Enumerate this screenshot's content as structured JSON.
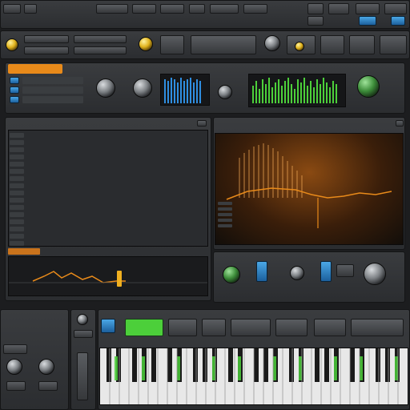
{
  "app": {
    "title": ""
  },
  "top_bar": {
    "items": [
      "",
      "",
      "",
      "",
      ""
    ],
    "status_text": ""
  },
  "instrument_panel": {
    "preset_name": "",
    "track_labels": [
      "",
      "",
      "",
      "",
      ""
    ]
  },
  "editor": {
    "title": "",
    "rows": [
      "",
      "",
      "",
      "",
      "",
      "",
      "",
      "",
      "",
      "",
      "",
      "",
      "",
      "",
      "",
      ""
    ]
  },
  "analyzer": {
    "title": "",
    "header_label": ""
  },
  "effects_panel": {
    "label": ""
  },
  "bottom_left": {
    "label": ""
  },
  "colors": {
    "accent_orange": "#e88a1a",
    "accent_green": "#4ccf3a",
    "accent_blue": "#2f8ee0",
    "panel_dark": "#2b2d30"
  }
}
